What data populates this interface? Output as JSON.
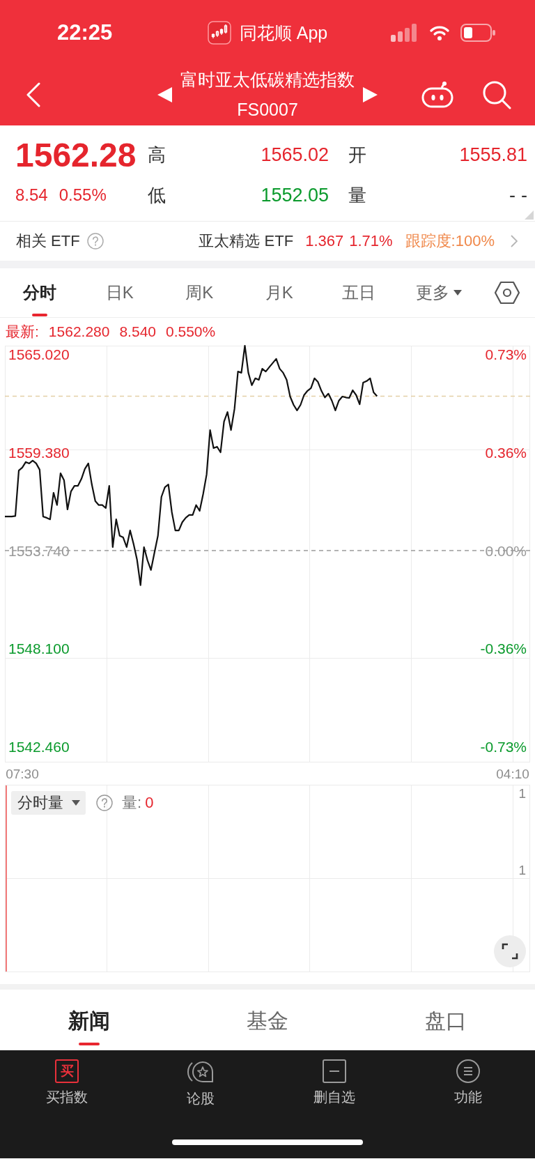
{
  "status_bar": {
    "time": "22:25",
    "app_name": "同花顺 App"
  },
  "nav": {
    "title": "富时亚太低碳精选指数",
    "code": "FS0007"
  },
  "quote": {
    "price": "1562.28",
    "change": "8.54",
    "change_pct": "0.55%",
    "color": "#e5252d",
    "stats": [
      {
        "label": "高",
        "value": "1565.02",
        "color": "#e5252d"
      },
      {
        "label": "开",
        "value": "1555.81",
        "color": "#e5252d"
      },
      {
        "label": "低",
        "value": "1552.05",
        "color": "#0a9a2c"
      },
      {
        "label": "量",
        "value": "--",
        "color": "#333333"
      }
    ]
  },
  "related_etf": {
    "label": "相关 ETF",
    "name": "亚太精选 ETF",
    "price": "1.367",
    "change_pct": "1.71%",
    "tracking": "跟踪度:100%"
  },
  "chart_tabs": [
    {
      "label": "分时",
      "kind": "tab",
      "selected": true
    },
    {
      "label": "日K",
      "kind": "tab",
      "selected": false
    },
    {
      "label": "周K",
      "kind": "tab",
      "selected": false
    },
    {
      "label": "月K",
      "kind": "tab",
      "selected": false
    },
    {
      "label": "五日",
      "kind": "tab",
      "selected": false
    },
    {
      "label": "更多",
      "kind": "dropdown",
      "selected": false
    }
  ],
  "latest": {
    "label": "最新:",
    "price": "1562.280",
    "change": "8.540",
    "change_pct": "0.550%"
  },
  "price_chart": {
    "percent_labels": [
      "0.73%",
      "0.36%",
      "0.00%",
      "-0.36%",
      "-0.73%"
    ],
    "chart_data": {
      "type": "line",
      "categories": [
        null,
        null,
        null,
        null,
        null,
        "07:30",
        null,
        null,
        null,
        null,
        null,
        null,
        null,
        null,
        null,
        null,
        null,
        null,
        null,
        null,
        null,
        null,
        null,
        null,
        null,
        null,
        null,
        null,
        null,
        null,
        null,
        null,
        null,
        null,
        null,
        null,
        null,
        null,
        null,
        null,
        null,
        null,
        null,
        null,
        null,
        null,
        null,
        null,
        null,
        null,
        null,
        null,
        null,
        null,
        null,
        null,
        null,
        null,
        null,
        null,
        null,
        null,
        null,
        null,
        null,
        null,
        null,
        null,
        null,
        null,
        null,
        null,
        null,
        null,
        null,
        null,
        null,
        null,
        null,
        null,
        null,
        null,
        null,
        null,
        null,
        null,
        null,
        null,
        null,
        null,
        null,
        null,
        null,
        null,
        null,
        null,
        null,
        null,
        null,
        null,
        null,
        null,
        null,
        null,
        null,
        null,
        null,
        null,
        null,
        null,
        null,
        null,
        null,
        null,
        null,
        null,
        null,
        null,
        null,
        null,
        null,
        null,
        null,
        null,
        null,
        null,
        null,
        null,
        null,
        null,
        null,
        null,
        null,
        null,
        null,
        null,
        null,
        null,
        null,
        null,
        null,
        null,
        null,
        null,
        null,
        null,
        "04:10",
        null,
        null,
        null,
        null,
        null
      ],
      "series": [
        {
          "color": "#111111",
          "values": [
            1555.7,
            1555.7,
            1555.7,
            1555.73,
            1558.35,
            1558.52,
            1558.84,
            1558.76,
            1558.92,
            1558.76,
            1558.4,
            1555.7,
            1555.63,
            1555.54,
            1557.07,
            1556.36,
            1558.19,
            1557.8,
            1556.11,
            1557.15,
            1557.47,
            1557.47,
            1557.87,
            1558.44,
            1558.76,
            1557.55,
            1556.59,
            1556.36,
            1556.36,
            1556.19,
            1557.47,
            1553.94,
            1555.54,
            1554.59,
            1554.5,
            1553.94,
            1554.9,
            1554.11,
            1553.22,
            1551.75,
            1553.94,
            1553.18,
            1552.62,
            1553.62,
            1554.59,
            1556.83,
            1557.39,
            1557.55,
            1555.95,
            1554.9,
            1554.9,
            1555.38,
            1555.63,
            1555.79,
            1555.79,
            1556.36,
            1556.03,
            1556.99,
            1558.12,
            1560.68,
            1559.64,
            1559.72,
            1559.4,
            1561.17,
            1561.72,
            1560.68,
            1561.89,
            1564.05,
            1563.98,
            1565.54,
            1563.98,
            1563.26,
            1563.66,
            1563.57,
            1564.21,
            1564.05,
            1564.3,
            1564.54,
            1564.78,
            1564.21,
            1563.98,
            1563.57,
            1562.61,
            1562.13,
            1561.81,
            1562.13,
            1562.69,
            1562.94,
            1563.1,
            1563.66,
            1563.45,
            1562.94,
            1562.56,
            1562.78,
            1562.37,
            1561.81,
            1562.37,
            1562.61,
            1562.56,
            1562.53,
            1562.97,
            1562.69,
            1562.16,
            1563.41,
            1563.5,
            1563.66,
            1562.85,
            1562.63,
            null,
            null,
            null,
            null,
            null,
            null,
            null,
            null,
            null,
            null,
            null,
            null,
            null,
            null,
            null,
            null,
            null,
            null,
            null,
            null,
            null,
            null,
            null,
            null,
            null,
            null,
            null,
            null,
            null,
            null,
            null,
            null,
            null,
            null,
            null,
            null,
            null,
            null,
            null,
            null,
            null,
            null,
            null,
            null
          ]
        }
      ],
      "ylim": [
        1541.54,
        1565.54
      ],
      "yticks": [
        {
          "value": 1565.02,
          "label": "1565.020"
        },
        {
          "value": 1559.38,
          "label": "1559.380"
        },
        {
          "value": 1553.74,
          "label": "1553.740"
        },
        {
          "value": 1548.1,
          "label": "1548.100"
        },
        {
          "value": 1542.46,
          "label": "1542.460"
        }
      ],
      "ref_lines": [
        {
          "axis": "y",
          "value": 1553.74,
          "color": "#9a9a9a"
        },
        {
          "axis": "y",
          "value": 1562.63,
          "color": "#e4cfa6"
        }
      ]
    }
  },
  "volume_chart": {
    "selector": "分时量",
    "label": "量:",
    "value": "0",
    "right_labels": [
      "1",
      "1"
    ]
  },
  "bottom_tabs": [
    {
      "label": "新闻",
      "selected": true
    },
    {
      "label": "基金",
      "selected": false
    },
    {
      "label": "盘口",
      "selected": false
    }
  ],
  "toolbar": [
    {
      "label": "买指数",
      "kind": "buy",
      "icon_text": "买"
    },
    {
      "label": "论股",
      "kind": "forum"
    },
    {
      "label": "删自选",
      "kind": "remove"
    },
    {
      "label": "功能",
      "kind": "menu"
    }
  ]
}
